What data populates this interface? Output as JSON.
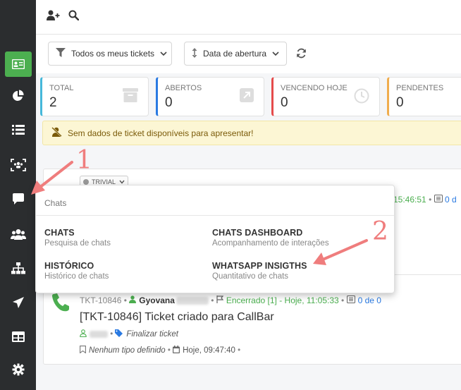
{
  "filters": {
    "scope_label": "Todos os meus tickets",
    "sort_label": "Data de abertura"
  },
  "stats": [
    {
      "label": "TOTAL",
      "value": "2",
      "color": "#46b8da"
    },
    {
      "label": "ABERTOS",
      "value": "0",
      "color": "#2a7ae2"
    },
    {
      "label": "VENCENDO HOJE",
      "value": "0",
      "color": "#e54b4b"
    },
    {
      "label": "PENDENTES",
      "value": "0",
      "color": "#f0ad4e"
    }
  ],
  "alert": {
    "text": "Sem dados de ticket disponíveis para apresentar!"
  },
  "ticket1": {
    "tag": "TRIVIAL",
    "time": "15:46:51",
    "count": "0 d"
  },
  "ticket2": {
    "id": "TKT-10846",
    "contact": "Gyovana",
    "status": "Encerrado [1] - Hoje, 11:05:33",
    "count": "0 de 0",
    "title": "[TKT-10846] Ticket criado para CallBar",
    "action": "Finalizar ticket",
    "type": "Nenhum tipo definido",
    "opened": "Hoje, 09:47:40"
  },
  "popup": {
    "header": "Chats",
    "items": [
      {
        "title": "CHATS",
        "subtitle": "Pesquisa de chats"
      },
      {
        "title": "CHATS DASHBOARD",
        "subtitle": "Acompanhamento de interações"
      },
      {
        "title": "HISTÓRICO",
        "subtitle": "Histórico de chats"
      },
      {
        "title": "WHATSAPP INSIGTHS",
        "subtitle": "Quantitativo de chats"
      }
    ]
  },
  "annotations": {
    "one": "1",
    "two": "2"
  },
  "colors": {
    "sidebar": "#2b2d2f",
    "active": "#4caf50",
    "annotation": "#ef7d7d"
  }
}
